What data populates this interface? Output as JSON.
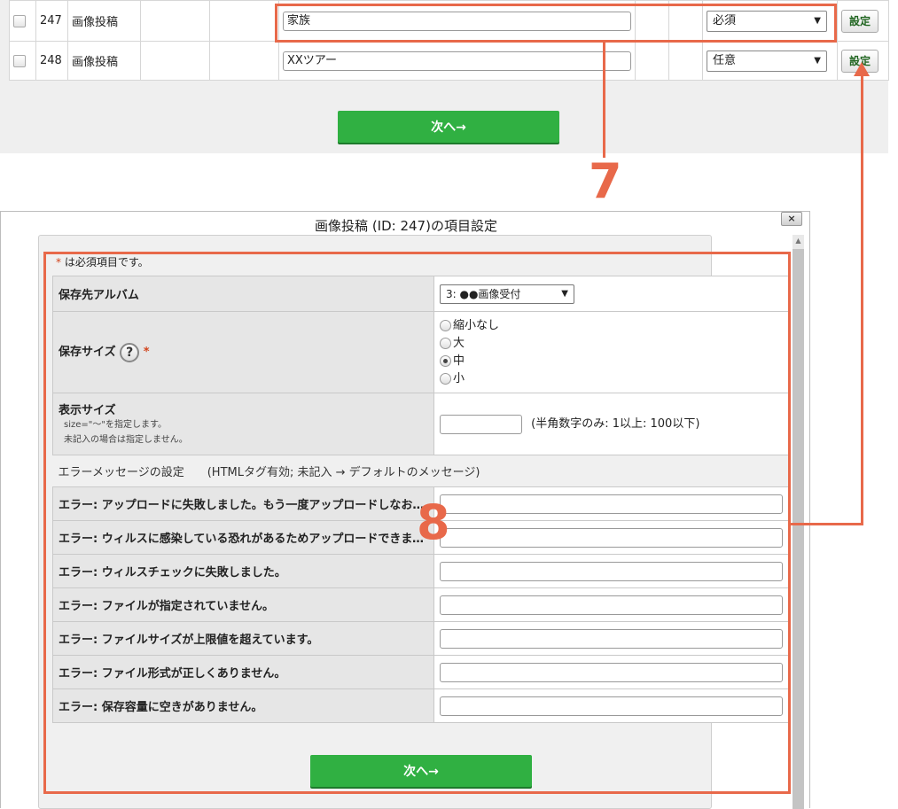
{
  "top_table": {
    "rows": [
      {
        "id": "247",
        "type": "画像投稿",
        "name": "家族",
        "required": "必須",
        "set_label": "設定"
      },
      {
        "id": "248",
        "type": "画像投稿",
        "name": "XXツアー",
        "required": "任意",
        "set_label": "設定"
      }
    ],
    "next_label": "次へ→"
  },
  "annotations": {
    "seven": "7",
    "eight": "8",
    "accent": "#e8694a"
  },
  "dialog": {
    "title": "画像投稿 (ID: 247)の項目設定",
    "close_label": "×",
    "required_note_star": "*",
    "required_note": " は必須項目です。",
    "album": {
      "label": "保存先アルバム",
      "value": "3: ●●画像受付"
    },
    "save_size": {
      "label": "保存サイズ",
      "help": "?",
      "star": "*",
      "options": [
        "縮小なし",
        "大",
        "中",
        "小"
      ],
      "selected_index": 2
    },
    "display_size": {
      "label": "表示サイズ",
      "note1": "size=\"～\"を指定します。",
      "note2": "未記入の場合は指定しません。",
      "hint": "(半角数字のみ: 1以上: 100以下)"
    },
    "error_section": "エラーメッセージの設定　　(HTMLタグ有効; 未記入 → デフォルトのメッセージ)",
    "errors": [
      "エラー: アップロードに失敗しました。もう一度アップロードしなおしてください。",
      "エラー: ウィルスに感染している恐れがあるためアップロードできません。",
      "エラー: ウィルスチェックに失敗しました。",
      "エラー: ファイルが指定されていません。",
      "エラー: ファイルサイズが上限値を超えています。",
      "エラー: ファイル形式が正しくありません。",
      "エラー: 保存容量に空きがありません。"
    ],
    "next_label": "次へ→"
  },
  "colors": {
    "green": "#30b042",
    "accent": "#e8694a",
    "label_bg": "#e6e6e6"
  }
}
